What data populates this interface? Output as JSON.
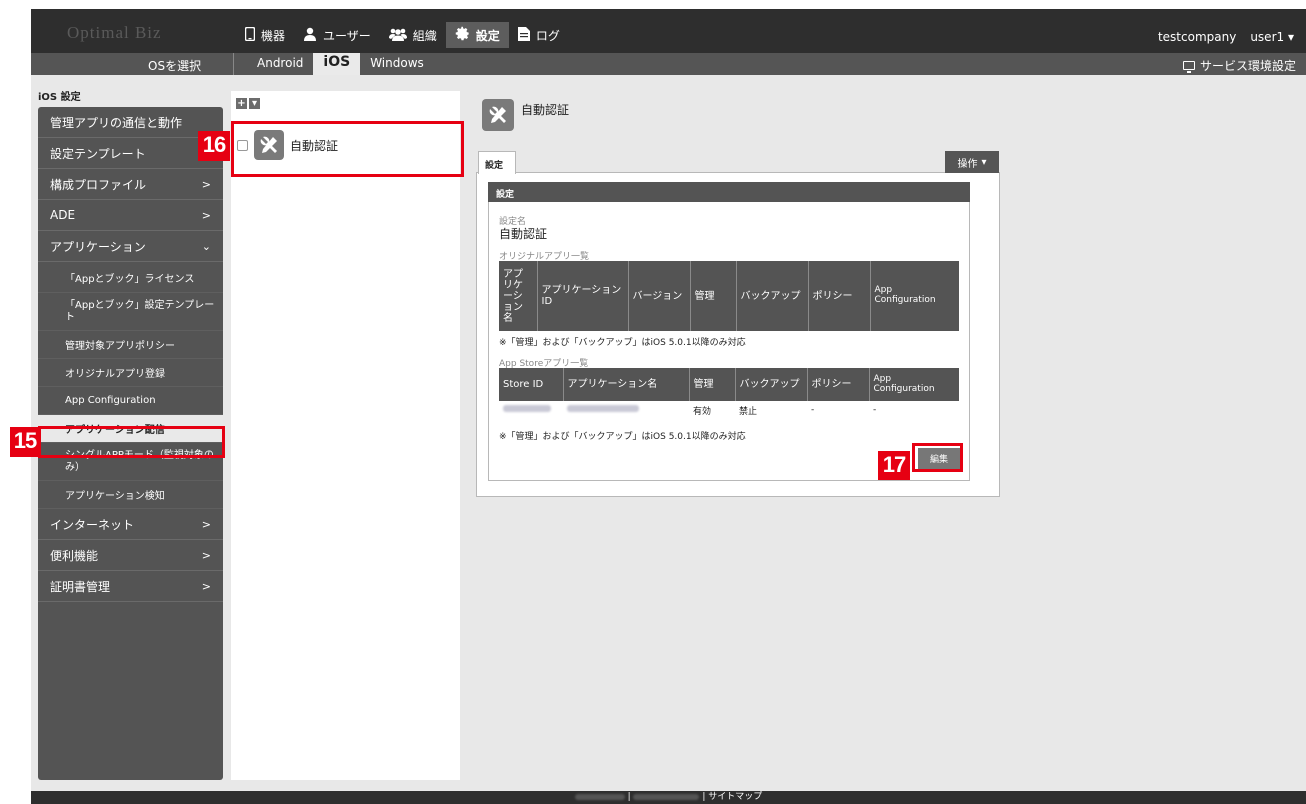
{
  "app": {
    "logo": "Optimal Biz"
  },
  "nav": {
    "items": [
      {
        "label": "機器",
        "icon": "device-icon"
      },
      {
        "label": "ユーザー",
        "icon": "user-icon"
      },
      {
        "label": "組織",
        "icon": "group-icon"
      },
      {
        "label": "設定",
        "icon": "gear-icon"
      },
      {
        "label": "ログ",
        "icon": "document-icon"
      }
    ],
    "company": "testcompany",
    "user": "user1"
  },
  "subbar": {
    "os_label": "OSを選択",
    "tabs": [
      "Android",
      "iOS",
      "Windows"
    ],
    "service_env": "サービス環境設定"
  },
  "sidebar": {
    "section_label": "iOS 設定",
    "items": [
      "管理アプリの通信と動作",
      "設定テンプレート",
      "構成プロファイル",
      "ADE",
      "アプリケーション",
      "「Appとブック」ライセンス",
      "「Appとブック」設定テンプレート",
      "管理対象アプリポリシー",
      "オリジナルアプリ登録",
      "App Configuration",
      "アプリケーション配信",
      "シングルAPPモード（監視対象のみ）",
      "アプリケーション検知",
      "インターネット",
      "便利機能",
      "証明書管理"
    ]
  },
  "middle": {
    "profile_name": "自動認証"
  },
  "detail": {
    "title": "自動認証",
    "tab_label": "設定",
    "ops_label": "操作",
    "section_header": "設定",
    "setting_name_label": "設定名",
    "setting_name_value": "自動認証",
    "original_list_label": "オリジナルアプリ一覧",
    "original_columns": [
      "アプリケーション名",
      "アプリケーションID",
      "バージョン",
      "管理",
      "バックアップ",
      "ポリシー",
      "App Configuration"
    ],
    "note1": "※「管理」および「バックアップ」はiOS 5.0.1以降のみ対応",
    "appstore_list_label": "App Storeアプリ一覧",
    "appstore_columns": [
      "Store ID",
      "アプリケーション名",
      "管理",
      "バックアップ",
      "ポリシー",
      "App Configuration"
    ],
    "appstore_row": {
      "management": "有効",
      "backup": "禁止",
      "policy": "-",
      "appconfig": "-"
    },
    "note2": "※「管理」および「バックアップ」はiOS 5.0.1以降のみ対応",
    "edit_label": "編集"
  },
  "callouts": [
    "15",
    "16",
    "17"
  ],
  "footer": {
    "sitemap": "サイトマップ"
  },
  "colors": {
    "callout": "#e60012",
    "dark_bar": "#2e2e2e",
    "sidebar": "#545454"
  }
}
